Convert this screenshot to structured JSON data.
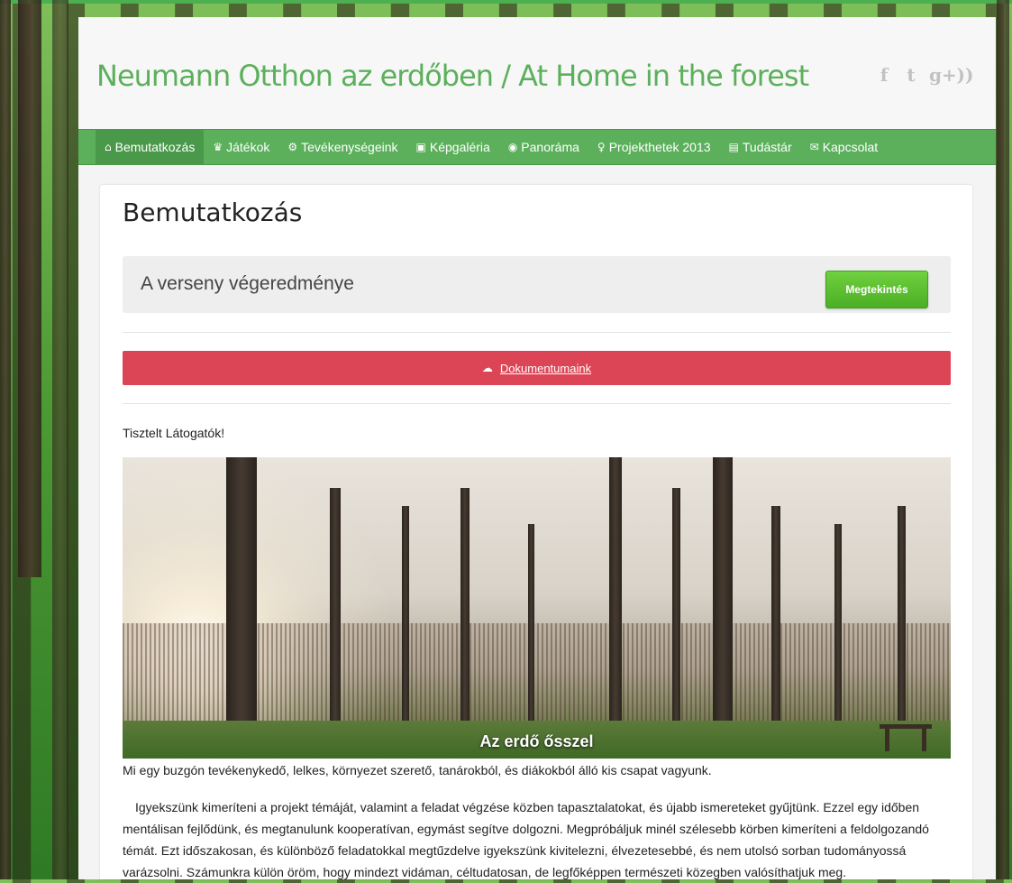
{
  "site": {
    "title": "Neumann Otthon az erdőben / At Home in the forest"
  },
  "social": [
    {
      "name": "facebook-icon",
      "glyph": "f"
    },
    {
      "name": "twitter-icon",
      "glyph": "t"
    },
    {
      "name": "google-plus-icon",
      "glyph": "g+"
    },
    {
      "name": "rss-icon",
      "glyph": "))"
    }
  ],
  "nav": {
    "items": [
      {
        "label": "Bemutatkozás",
        "icon": "home-icon",
        "glyph": "⌂",
        "active": true
      },
      {
        "label": "Játékok",
        "icon": "trophy-icon",
        "glyph": "♛",
        "active": false
      },
      {
        "label": "Tevékenységeink",
        "icon": "cogs-icon",
        "glyph": "⚙",
        "active": false
      },
      {
        "label": "Képgaléria",
        "icon": "picture-icon",
        "glyph": "▣",
        "active": false
      },
      {
        "label": "Panoráma",
        "icon": "eye-icon",
        "glyph": "◉",
        "active": false
      },
      {
        "label": "Projekthetek 2013",
        "icon": "lightbulb-icon",
        "glyph": "♀",
        "active": false
      },
      {
        "label": "Tudástár",
        "icon": "book-icon",
        "glyph": "▤",
        "active": false
      },
      {
        "label": "Kapcsolat",
        "icon": "envelope-icon",
        "glyph": "✉",
        "active": false
      }
    ]
  },
  "content": {
    "page_title": "Bemutatkozás",
    "result_box": {
      "text": "A verseny végeredménye",
      "button_label": "Megtekintés"
    },
    "docs": {
      "icon": "cloud-download-icon",
      "glyph": "☁",
      "label": "Dokumentumaink"
    },
    "greeting": "Tisztelt Látogatók!",
    "photo": {
      "caption": "Az erdő ősszel"
    },
    "paragraph1": "Mi egy buzgón tevékenykedő, lelkes, környezet szerető, tanárokból, és diákokból álló kis csapat vagyunk.",
    "paragraph2": "Igyekszünk kimeríteni a projekt témáját, valamint a feladat végzése közben tapasztalatokat, és újabb ismereteket gyűjtünk. Ezzel egy időben mentálisan fejlődünk, és megtanulunk kooperatívan, egymást segítve dolgozni. Megpróbáljuk minél szélesebb körben kimeríteni a feldolgozandó témát. Ezt időszakosan, és különböző feladatokkal megtűzdelve igyekszünk kivitelezni, élvezetesebbé, és nem utolsó sorban tudományossá varázsolni. Számunkra külön öröm, hogy mindezt vidáman, céltudatosan, de legfőképpen természeti közegben valósíthatjuk meg."
  },
  "colors": {
    "brand_green": "#5cb05c",
    "nav_active": "#4a984a",
    "button_green": "#4cae24",
    "docs_red": "#dc4555"
  }
}
